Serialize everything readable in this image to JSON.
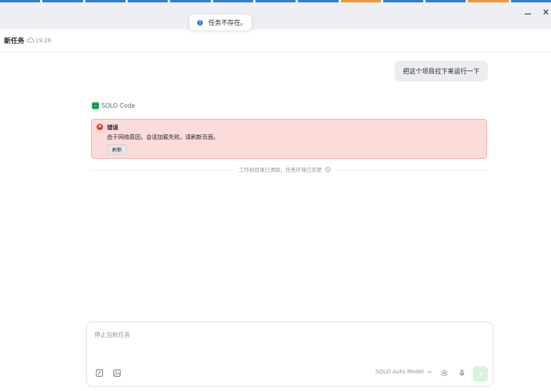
{
  "colors": {
    "stripe_blue": "#2f7fd3",
    "stripe_orange": "#f0953e",
    "toast_info": "#3370ff",
    "error_red": "#e5382f",
    "error_bg": "#fbdcdb",
    "send_bg": "#d4f4de",
    "brand_green": "#2fbe6a"
  },
  "top_stripes": [
    "blue",
    "blue",
    "blue",
    "blue",
    "blue",
    "blue",
    "blue",
    "blue",
    "orange",
    "blue",
    "blue",
    "orange",
    "blue"
  ],
  "window_controls": {
    "close_glyph": "✕"
  },
  "toast": {
    "icon": "info-icon",
    "text": "任务不存在。"
  },
  "header": {
    "title": "新任务",
    "time": "19:26"
  },
  "user_message": {
    "text": "把这个项目拉下来运行一下"
  },
  "agent": {
    "name": "SOLO Code"
  },
  "error": {
    "title": "错误",
    "message": "由于网络原因，会话加载失败。请刷新页面。",
    "button": "刷新"
  },
  "notice": {
    "text": "工作树目录已清除，任务环境已变更"
  },
  "composer": {
    "placeholder": "停止当前任务",
    "model": "SOLO Auto Model"
  }
}
